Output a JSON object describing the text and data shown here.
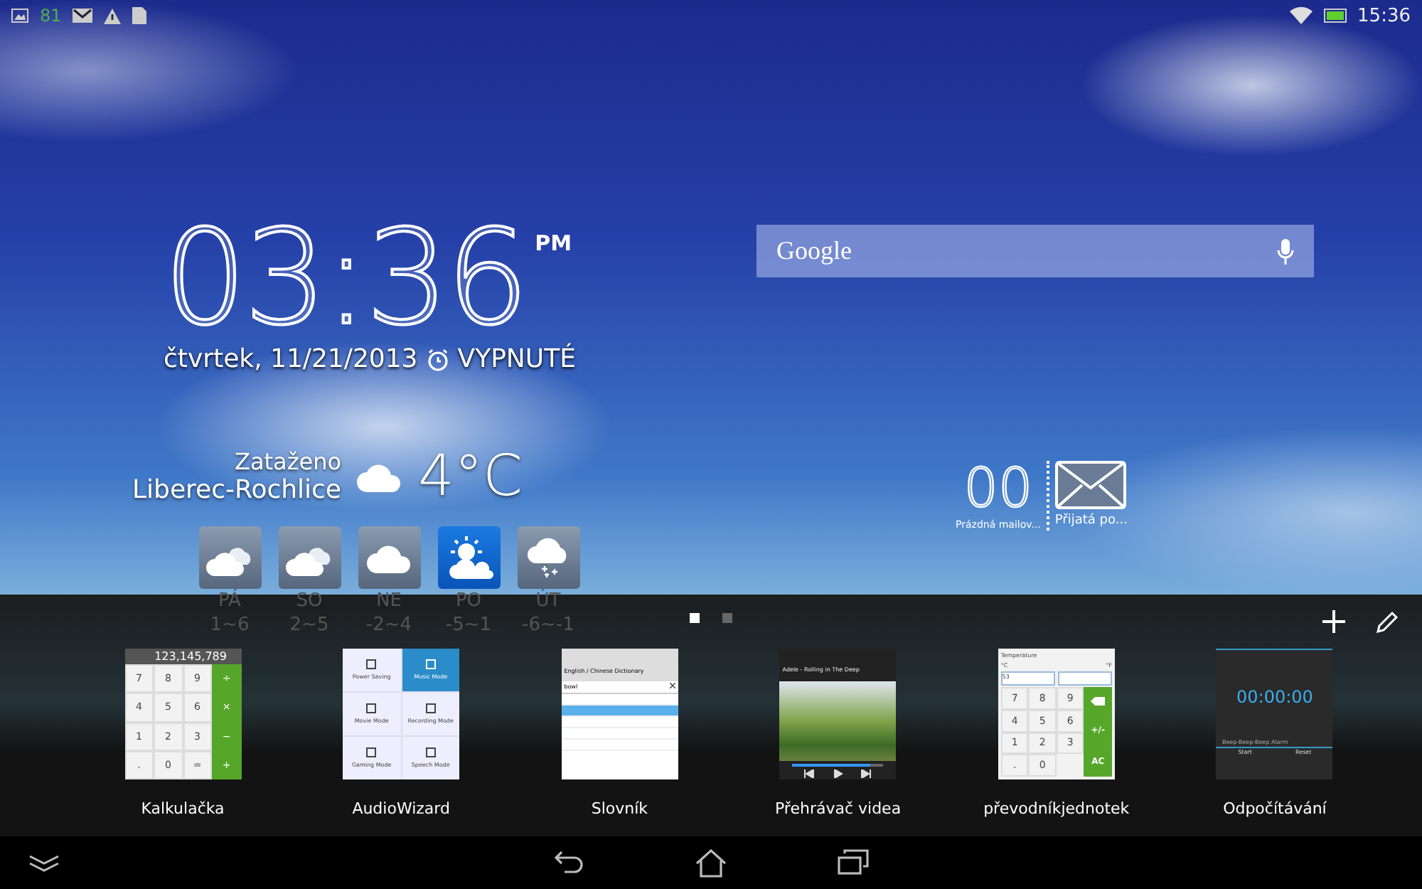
{
  "status_bar": {
    "notification_count": "81",
    "time": "15:36"
  },
  "clock": {
    "time": "03:36",
    "ampm": "PM",
    "date": "čtvrtek, 11/21/2013",
    "alarm": "VYPNUTÉ"
  },
  "weather": {
    "condition": "Zataženo",
    "location": "Liberec-Rochlice",
    "temperature": "4°C",
    "forecast": [
      {
        "day": "PÁ",
        "range": "1~6",
        "kind": "partly-cloudy",
        "selected": false
      },
      {
        "day": "SO",
        "range": "2~5",
        "kind": "partly-cloudy",
        "selected": false
      },
      {
        "day": "NE",
        "range": "-2~4",
        "kind": "cloudy",
        "selected": false
      },
      {
        "day": "PO",
        "range": "-5~1",
        "kind": "sunny-cloudy",
        "selected": true
      },
      {
        "day": "ÚT",
        "range": "-6~-1",
        "kind": "snow",
        "selected": false
      }
    ]
  },
  "search": {
    "logo": "Google"
  },
  "mail": {
    "count": "00",
    "empty_label": "Prázdná mailov...",
    "inbox_label": "Přijatá po..."
  },
  "page_dots": [
    {
      "selected": true
    },
    {
      "selected": false
    }
  ],
  "widgets": [
    {
      "kind": "calculator",
      "label": "Kalkulačka",
      "display": "123,145,789",
      "keys": [
        [
          "7",
          "8",
          "9",
          "÷"
        ],
        [
          "4",
          "5",
          "6",
          "×"
        ],
        [
          "1",
          "2",
          "3",
          "−"
        ],
        [
          ".",
          "0",
          "=",
          "+"
        ]
      ]
    },
    {
      "kind": "audiowizard",
      "label": "AudioWizard",
      "modes": [
        {
          "name": "Power Saving",
          "selected": false
        },
        {
          "name": "Music Mode",
          "selected": true
        },
        {
          "name": "Movie Mode",
          "selected": false
        },
        {
          "name": "Recording Mode",
          "selected": false
        },
        {
          "name": "Gaming Mode",
          "selected": false
        },
        {
          "name": "Speech Mode",
          "selected": false
        }
      ]
    },
    {
      "kind": "dictionary",
      "label": "Slovník",
      "title": "English / Chinese Dictionary",
      "query": "bowl"
    },
    {
      "kind": "video",
      "label": "Přehrávač videa",
      "title": "Adele - Rolling in The Deep",
      "level": 0.85
    },
    {
      "kind": "converter",
      "label": "převodníkjednotek",
      "category": "Temperature",
      "from": "°C",
      "to": "°F",
      "value": "53",
      "keys": [
        [
          "7",
          "8",
          "9"
        ],
        [
          "4",
          "5",
          "6"
        ],
        [
          "1",
          "2",
          "3"
        ],
        [
          ".",
          "0"
        ]
      ],
      "side_keys": [
        "+/-",
        "AC"
      ]
    },
    {
      "kind": "timer",
      "label": "Odpočítávání",
      "time": "00:00:00",
      "alarm": "Beep-Beep-Beep Alarm",
      "buttons": [
        "Start",
        "Reset"
      ]
    }
  ]
}
